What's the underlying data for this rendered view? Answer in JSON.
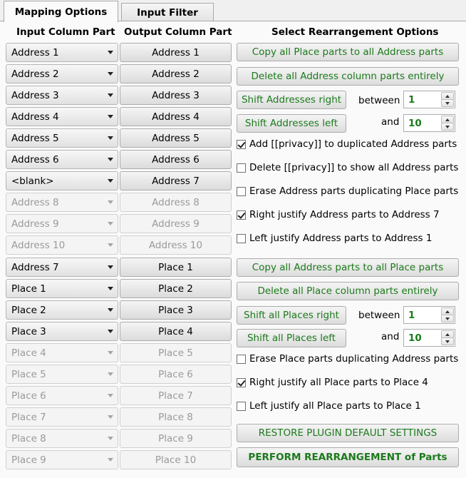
{
  "tabs": [
    "Mapping Options",
    "Input Filter"
  ],
  "headers": {
    "input": "Input Column Part",
    "output": "Output Column Part",
    "options": "Select Rearrangement Options"
  },
  "input_parts": [
    {
      "label": "Address 1",
      "enabled": true
    },
    {
      "label": "Address 2",
      "enabled": true
    },
    {
      "label": "Address 3",
      "enabled": true
    },
    {
      "label": "Address 4",
      "enabled": true
    },
    {
      "label": "Address 5",
      "enabled": true
    },
    {
      "label": "Address 6",
      "enabled": true
    },
    {
      "label": "<blank>",
      "enabled": true
    },
    {
      "label": "Address 8",
      "enabled": false
    },
    {
      "label": "Address 9",
      "enabled": false
    },
    {
      "label": "Address 10",
      "enabled": false
    },
    {
      "label": "Address 7",
      "enabled": true
    },
    {
      "label": "Place 1",
      "enabled": true
    },
    {
      "label": "Place 2",
      "enabled": true
    },
    {
      "label": "Place 3",
      "enabled": true
    },
    {
      "label": "Place 4",
      "enabled": false
    },
    {
      "label": "Place 5",
      "enabled": false
    },
    {
      "label": "Place 6",
      "enabled": false
    },
    {
      "label": "Place 7",
      "enabled": false
    },
    {
      "label": "Place 8",
      "enabled": false
    },
    {
      "label": "Place 9",
      "enabled": false
    }
  ],
  "output_parts": [
    {
      "label": "Address 1",
      "enabled": true
    },
    {
      "label": "Address 2",
      "enabled": true
    },
    {
      "label": "Address 3",
      "enabled": true
    },
    {
      "label": "Address 4",
      "enabled": true
    },
    {
      "label": "Address 5",
      "enabled": true
    },
    {
      "label": "Address 6",
      "enabled": true
    },
    {
      "label": "Address 7",
      "enabled": true
    },
    {
      "label": "Address 8",
      "enabled": false
    },
    {
      "label": "Address 9",
      "enabled": false
    },
    {
      "label": "Address 10",
      "enabled": false
    },
    {
      "label": "Place 1",
      "enabled": true
    },
    {
      "label": "Place 2",
      "enabled": true
    },
    {
      "label": "Place 3",
      "enabled": true
    },
    {
      "label": "Place 4",
      "enabled": true
    },
    {
      "label": "Place 5",
      "enabled": false
    },
    {
      "label": "Place 6",
      "enabled": false
    },
    {
      "label": "Place 7",
      "enabled": false
    },
    {
      "label": "Place 8",
      "enabled": false
    },
    {
      "label": "Place 9",
      "enabled": false
    },
    {
      "label": "Place 10",
      "enabled": false
    }
  ],
  "address": {
    "copy_label": "Copy all Place parts to all Address parts",
    "delete_label": "Delete all Address column parts entirely",
    "shift_right_label": "Shift Addresses right",
    "shift_left_label": "Shift Addresses left",
    "between_label": "between",
    "and_label": "and",
    "from_value": "1",
    "to_value": "10",
    "checkboxes": [
      {
        "label": "Add [[privacy]] to duplicated Address parts",
        "checked": true
      },
      {
        "label": "Delete [[privacy]] to show all Address parts",
        "checked": false
      },
      {
        "label": "Erase Address parts duplicating Place parts",
        "checked": false
      },
      {
        "label": "Right justify Address parts to Address 7",
        "checked": true
      },
      {
        "label": "Left justify Address parts to Address 1",
        "checked": false
      }
    ]
  },
  "place": {
    "copy_label": "Copy all Address parts to all Place parts",
    "delete_label": "Delete all Place column parts entirely",
    "shift_right_label": "Shift all Places right",
    "shift_left_label": "Shift all Places left",
    "between_label": "between",
    "and_label": "and",
    "from_value": "1",
    "to_value": "10",
    "checkboxes": [
      {
        "label": "Erase Place parts duplicating Address parts",
        "checked": false
      },
      {
        "label": "Right justify all Place parts to Place 4",
        "checked": true
      },
      {
        "label": "Left justify all Place parts to Place 1",
        "checked": false
      }
    ]
  },
  "footer": {
    "restore_label": "RESTORE PLUGIN DEFAULT SETTINGS",
    "perform_label": "PERFORM REARRANGEMENT of Parts"
  },
  "colors": {
    "accent_green": "#1c7a1c"
  }
}
